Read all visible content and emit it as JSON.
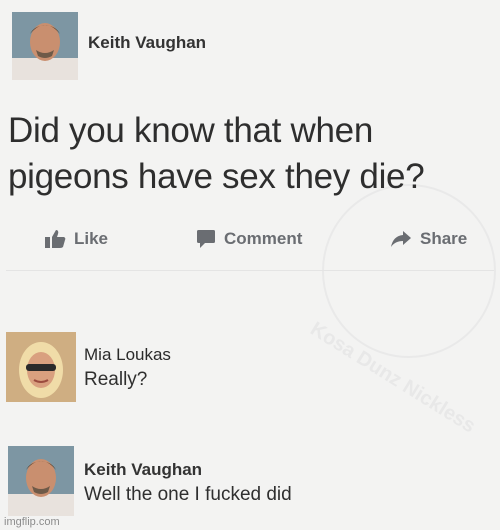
{
  "post": {
    "author": "Keith Vaughan",
    "text": "Did you know that when pigeons have sex they die?",
    "avatar_icon": "person-avatar-icon",
    "actions": [
      {
        "label": "Like",
        "icon": "thumbs-up-icon"
      },
      {
        "label": "Comment",
        "icon": "comment-icon"
      },
      {
        "label": "Share",
        "icon": "share-arrow-icon"
      }
    ]
  },
  "comments": [
    {
      "author": "Mia Loukas",
      "text": "Really?",
      "avatar_icon": "person-avatar-icon"
    },
    {
      "author": "Keith Vaughan",
      "text": "Well the one I fucked did",
      "avatar_icon": "person-avatar-icon"
    }
  ],
  "watermark": {
    "text": "Kosa Dunz Nickless"
  },
  "footer": {
    "text": "imgflip.com"
  },
  "colors": {
    "background": "#f3f3f2",
    "action_gray": "#6a6d72",
    "text": "#2e2e2e"
  }
}
